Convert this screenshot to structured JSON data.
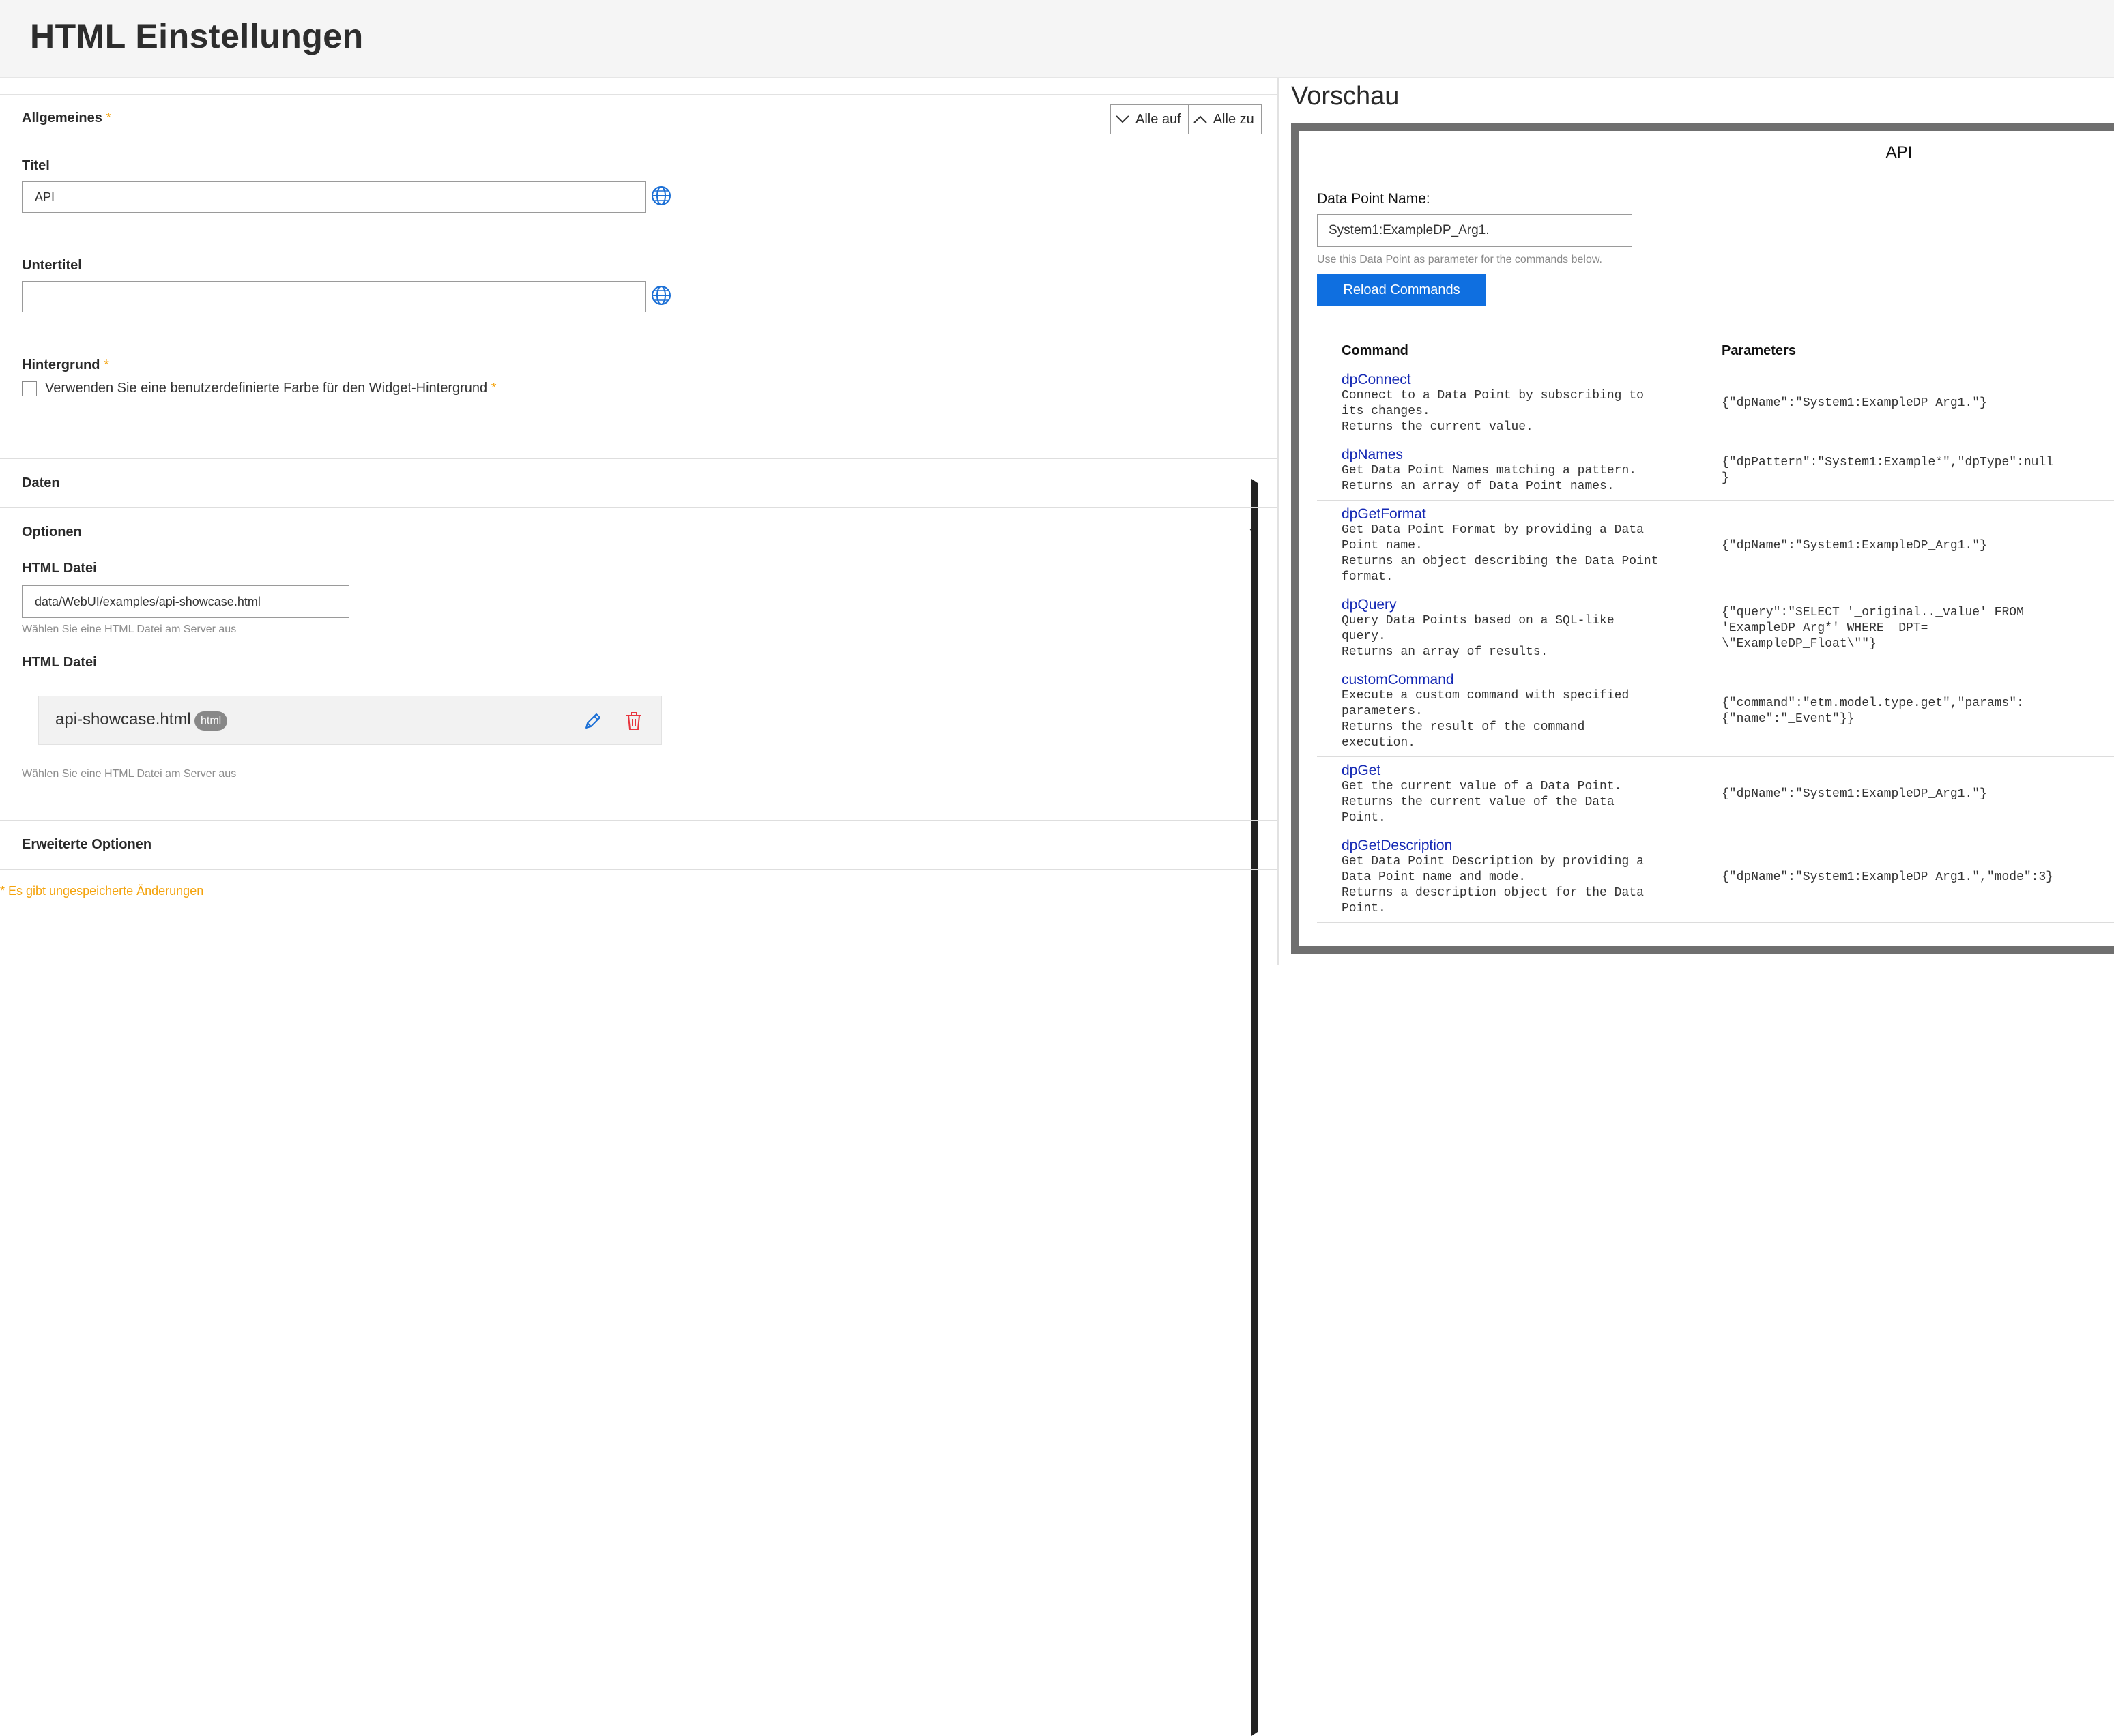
{
  "header": {
    "title": "HTML Einstellungen"
  },
  "colors": {
    "accent": "#0f6fe0",
    "required": "#f4a30c",
    "link": "#1428b4",
    "badge": "#888888",
    "danger": "#e8343e"
  },
  "general": {
    "title": "Allgemeines",
    "required_mark": "*",
    "expand_all": "Alle auf",
    "collapse_all": "Alle zu",
    "titel_label": "Titel",
    "titel_value": "API",
    "untertitel_label": "Untertitel",
    "untertitel_value": "",
    "hintergrund_label": "Hintergrund",
    "custom_color_label": "Verwenden Sie eine benutzerdefinierte Farbe für den Widget-Hintergrund",
    "custom_color_checked": false
  },
  "sections": {
    "daten": "Daten",
    "optionen": "Optionen",
    "erweitert": "Erweiterte Optionen"
  },
  "options": {
    "html_file_label": "HTML Datei",
    "html_file_path": "data/WebUI/examples/api-showcase.html",
    "html_file_hint": "Wählen Sie eine HTML Datei am Server aus",
    "html_file_label2": "HTML Datei",
    "file_name": "api-showcase.html",
    "file_badge": "html",
    "file_hint": "Wählen Sie eine HTML Datei am Server aus"
  },
  "unsaved_notice": "* Es gibt ungespeicherte Änderungen",
  "preview": {
    "title": "Vorschau",
    "widget_title": "API",
    "dp_label": "Data Point Name:",
    "dp_value": "System1:ExampleDP_Arg1.",
    "dp_hint": "Use this Data Point as parameter for the commands below.",
    "reload_button": "Reload Commands",
    "col_command": "Command",
    "col_parameters": "Parameters",
    "commands": [
      {
        "name": "dpConnect",
        "desc": "Connect to a Data Point by subscribing to\nits changes.\nReturns the current value.",
        "params": "{\"dpName\":\"System1:ExampleDP_Arg1.\"}"
      },
      {
        "name": "dpNames",
        "desc": "Get Data Point Names matching a pattern.\nReturns an array of Data Point names.",
        "params": "{\"dpPattern\":\"System1:Example*\",\"dpType\":null\n}"
      },
      {
        "name": "dpGetFormat",
        "desc": "Get Data Point Format by providing a Data\nPoint name.\nReturns an object describing the Data Point\nformat.",
        "params": "{\"dpName\":\"System1:ExampleDP_Arg1.\"}"
      },
      {
        "name": "dpQuery",
        "desc": "Query Data Points based on a SQL-like\nquery.\nReturns an array of results.",
        "params": "{\"query\":\"SELECT '_original.._value' FROM\n'ExampleDP_Arg*' WHERE _DPT=\n\\\"ExampleDP_Float\\\"\"}"
      },
      {
        "name": "customCommand",
        "desc": "Execute a custom command with specified\nparameters.\nReturns the result of the command\nexecution.",
        "params": "{\"command\":\"etm.model.type.get\",\"params\":\n{\"name\":\"_Event\"}}"
      },
      {
        "name": "dpGet",
        "desc": "Get the current value of a Data Point.\nReturns the current value of the Data\nPoint.",
        "params": "{\"dpName\":\"System1:ExampleDP_Arg1.\"}"
      },
      {
        "name": "dpGetDescription",
        "desc": "Get Data Point Description by providing a\nData Point name and mode.\nReturns a description object for the Data\nPoint.",
        "params": "{\"dpName\":\"System1:ExampleDP_Arg1.\",\"mode\":3}"
      }
    ]
  }
}
